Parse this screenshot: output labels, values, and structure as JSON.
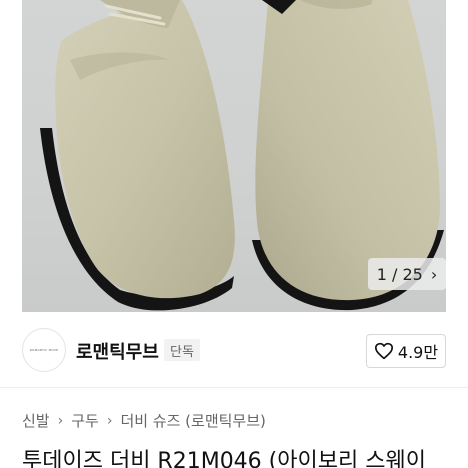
{
  "image_viewer": {
    "counter_current": "1",
    "counter_separator": "/",
    "counter_total": "25",
    "next_icon": "chevron-right-icon"
  },
  "seller": {
    "name": "로맨틱무브",
    "tag": "단독",
    "logo_text": "ROMANTIC MOVE",
    "like_count": "4.9만",
    "like_icon": "heart-outline-icon"
  },
  "breadcrumb": {
    "items": [
      "신발",
      "구두",
      "더비 슈즈 (로맨틱무브)"
    ],
    "separator_icon": "chevron-right-icon"
  },
  "product": {
    "title": "투데이즈 더비 R21M046 (아이보리 스웨이"
  },
  "colors": {
    "hero_bg": "#d0d2d2",
    "suede": "#c9c6ab",
    "sole": "#141414"
  }
}
